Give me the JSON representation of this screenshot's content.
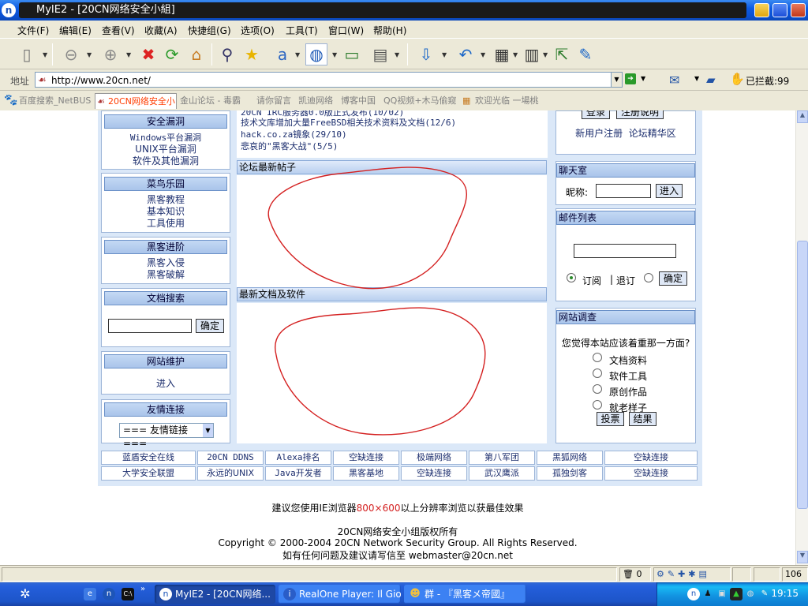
{
  "window": {
    "title": "MyIE2 - [20CN网络安全小組]"
  },
  "menu": [
    "文件(F)",
    "编辑(E)",
    "查看(V)",
    "收藏(A)",
    "快捷组(G)",
    "选项(O)",
    "工具(T)",
    "窗口(W)",
    "帮助(H)"
  ],
  "address": {
    "label": "地址",
    "url": "http://www.20cn.net/",
    "blocked": "已拦截:99"
  },
  "tabs": [
    "百度搜索_NetBUS",
    "20CN网络安全小",
    "金山论坛 - 毒霸",
    "请你留言",
    "凯迪网络",
    "博客中国",
    "QQ视频+木马偷窥",
    "欢迎光临 一場桃"
  ],
  "left": {
    "vuln": {
      "title": "安全漏洞",
      "items": [
        "Windows平台漏洞",
        "UNIX平台漏洞",
        "软件及其他漏洞"
      ]
    },
    "newbie": {
      "title": "菜鸟乐园",
      "items": [
        "黑客教程",
        "基本知识",
        "工具使用"
      ]
    },
    "advanced": {
      "title": "黑客进阶",
      "items": [
        "黑客入侵",
        "黑客破解"
      ]
    },
    "docsearch": {
      "title": "文档搜索",
      "button": "确定"
    },
    "maint": {
      "title": "网站维护",
      "link": "进入"
    },
    "friends": {
      "title": "友情连接",
      "select": "=== 友情链接 ==="
    }
  },
  "center": {
    "news": [
      "20CN IRC服务器0.0版正式发布(10/02)",
      "技术文库增加大量FreeBSD相关技术资料及文档(12/6)",
      "hack.co.za镜象(29/10)",
      "悲哀的\"黑客大战\"(5/5)"
    ],
    "forum_title": "论坛最新帖子",
    "docs_title": "最新文档及软件"
  },
  "right": {
    "login_buttons": [
      "登录",
      "注册说明"
    ],
    "register_links": "新用户注册  论坛精华区",
    "chat": {
      "title": "聊天室",
      "nick_label": "昵称:",
      "button": "进入"
    },
    "mail": {
      "title": "邮件列表",
      "subscribe": "订阅",
      "sep": "|",
      "unsubscribe": "退订",
      "button": "确定"
    },
    "survey": {
      "title": "网站调查",
      "question": "您觉得本站应该着重那一方面?",
      "options": [
        "文档资料",
        "软件工具",
        "原创作品",
        "就老样子"
      ],
      "vote": "投票",
      "result": "结果"
    }
  },
  "links": {
    "row1": [
      "蓝盾安全在线",
      "20CN DDNS",
      "Alexa排名",
      "空缺连接",
      "极端网络",
      "第八军团",
      "黑狐网络",
      "空缺连接"
    ],
    "row2": [
      "大学安全联盟",
      "永远的UNIX",
      "Java开发者",
      "黑客基地",
      "空缺连接",
      "武汉鹰派",
      "孤独剑客",
      "空缺连接"
    ]
  },
  "footer": {
    "recommend_pre": "建议您使用IE浏览器",
    "recommend_res": "800×600",
    "recommend_post": "以上分辨率浏览以获最佳效果",
    "copyright_cn": "20CN网络安全小组版权所有",
    "copyright_en": "Copyright © 2000-2004 20CN Network Security Group. All Rights Reserved.",
    "contact": "如有任何问题及建议请写信至  webmaster@20cn.net"
  },
  "status": {
    "count": "0",
    "zoom": "106"
  },
  "taskbar": {
    "tasks": [
      "MyIE2 - [20CN网络...",
      "RealOne Player: Il Gioco",
      "群 - 『黑客メ帝國』"
    ],
    "clock": "19:15"
  },
  "colors": {
    "accent_red": "#ff3c00",
    "link_blue": "#1c2e6e",
    "header_blue": "#a9c4ea"
  }
}
